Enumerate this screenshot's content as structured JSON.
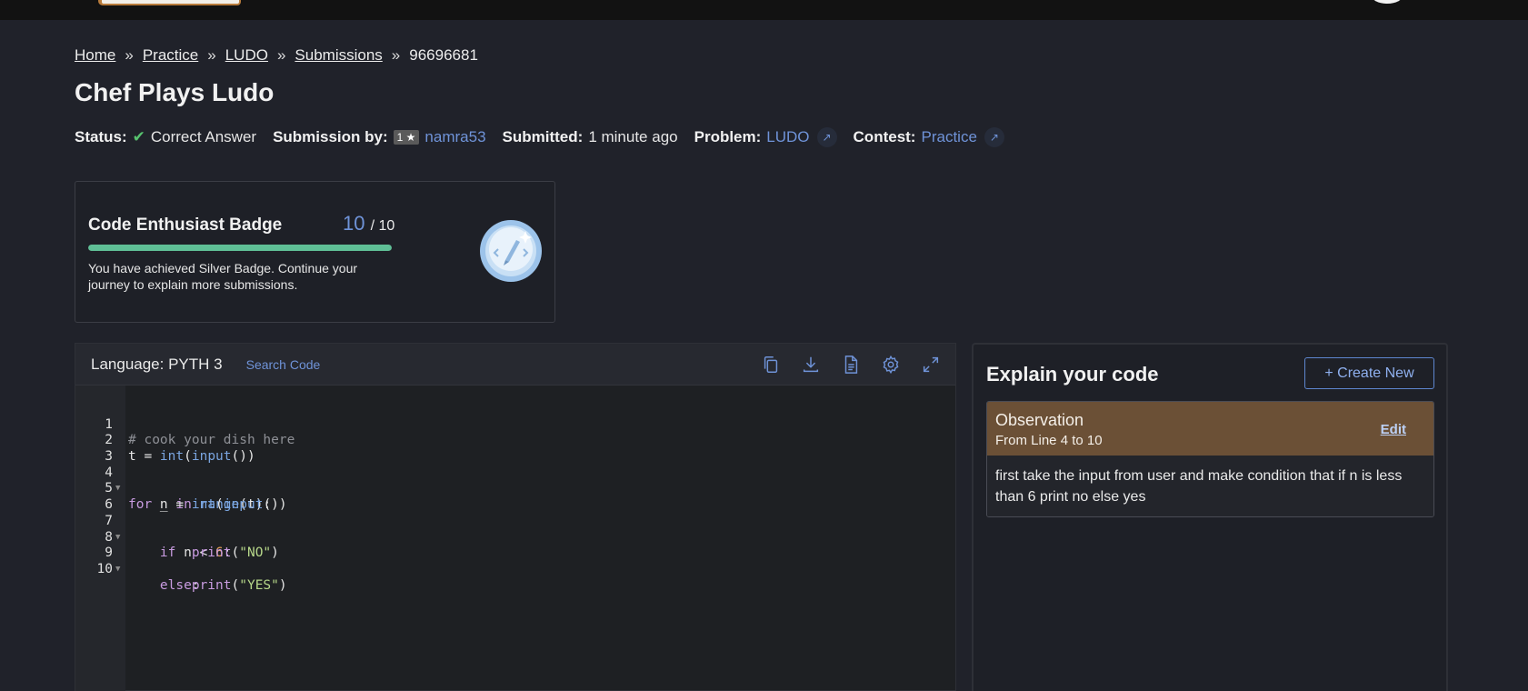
{
  "breadcrumb": {
    "items": [
      "Home",
      "Practice",
      "LUDO",
      "Submissions"
    ],
    "separator": "»",
    "current": "96696681"
  },
  "page_title": "Chef Plays Ludo",
  "meta": {
    "status_label": "Status:",
    "status_value": "Correct Answer",
    "submission_by_label": "Submission by:",
    "rating": "1 ★",
    "user": "namra53",
    "submitted_label": "Submitted:",
    "submitted_value": "1 minute ago",
    "problem_label": "Problem:",
    "problem_value": "LUDO",
    "contest_label": "Contest:",
    "contest_value": "Practice"
  },
  "badge": {
    "title": "Code Enthusiast Badge",
    "score": "10",
    "total": "/ 10",
    "progress": 1.0,
    "description": "You have achieved Silver Badge. Continue your journey to explain more submissions."
  },
  "editor": {
    "language": "Language: PYTH 3",
    "search_code": "Search Code",
    "tools": [
      "copy-icon",
      "download-icon",
      "file-icon",
      "settings-icon",
      "fullscreen-icon"
    ],
    "lines": [
      "# cook your dish here",
      "t = int(input())",
      "",
      "for _ in range(t):",
      "    n = int(input())",
      "",
      "    if n < 6:",
      "        print(\"NO\")",
      "    else:",
      "        print(\"YES\")"
    ],
    "line_numbers": [
      "1",
      "2",
      "3",
      "4",
      "5",
      "6",
      "7",
      "8",
      "9",
      "10"
    ]
  },
  "explain": {
    "title": "Explain your code",
    "create_button": "+ Create New",
    "observation": {
      "title": "Observation",
      "range": "From Line 4 to 10",
      "edit": "Edit",
      "body": "first take the input from user and make condition that if n is less than 6 print no else yes"
    }
  },
  "colors": {
    "background": "#20222a",
    "accent": "#6f93d8",
    "success": "#57c26e",
    "progress": "#5fbf96",
    "observation_header": "#6b5036"
  }
}
